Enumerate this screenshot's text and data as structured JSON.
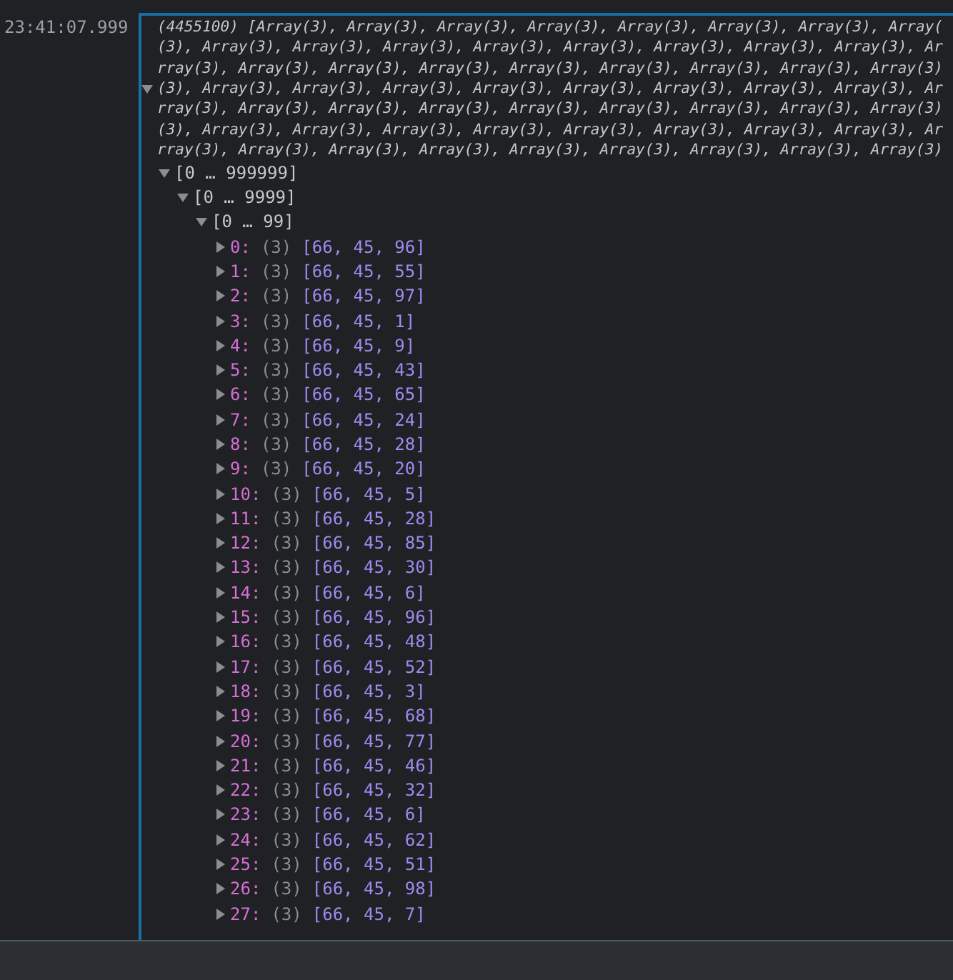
{
  "console_entry": {
    "timestamp": "23:41:07.999",
    "expanded": true,
    "summary_lines": [
      "(4455100) [Array(3), Array(3), Array(3), Array(3), Array(3), Array(3), Array(3), Array(",
      "(3), Array(3), Array(3), Array(3), Array(3), Array(3), Array(3), Array(3), Array(3), Ar",
      "rray(3), Array(3), Array(3), Array(3), Array(3), Array(3), Array(3), Array(3), Array(3)",
      "(3), Array(3), Array(3), Array(3), Array(3), Array(3), Array(3), Array(3), Array(3), Ar",
      "rray(3), Array(3), Array(3), Array(3), Array(3), Array(3), Array(3), Array(3), Array(3)",
      "(3), Array(3), Array(3), Array(3), Array(3), Array(3), Array(3), Array(3), Array(3), Ar",
      "rray(3), Array(3), Array(3), Array(3), Array(3), Array(3), Array(3), Array(3), Array(3)"
    ],
    "children": [
      {
        "label": "[0 … 999999]",
        "expanded": true,
        "children": [
          {
            "label": "[0 … 9999]",
            "expanded": true,
            "children": [
              {
                "label": "[0 … 99]",
                "expanded": true,
                "children": [
                  {
                    "key": "0:",
                    "count": "(3)",
                    "value": "[66, 45, 96]",
                    "expanded": false
                  },
                  {
                    "key": "1:",
                    "count": "(3)",
                    "value": "[66, 45, 55]",
                    "expanded": false
                  },
                  {
                    "key": "2:",
                    "count": "(3)",
                    "value": "[66, 45, 97]",
                    "expanded": false
                  },
                  {
                    "key": "3:",
                    "count": "(3)",
                    "value": "[66, 45, 1]",
                    "expanded": false
                  },
                  {
                    "key": "4:",
                    "count": "(3)",
                    "value": "[66, 45, 9]",
                    "expanded": false
                  },
                  {
                    "key": "5:",
                    "count": "(3)",
                    "value": "[66, 45, 43]",
                    "expanded": false
                  },
                  {
                    "key": "6:",
                    "count": "(3)",
                    "value": "[66, 45, 65]",
                    "expanded": false
                  },
                  {
                    "key": "7:",
                    "count": "(3)",
                    "value": "[66, 45, 24]",
                    "expanded": false
                  },
                  {
                    "key": "8:",
                    "count": "(3)",
                    "value": "[66, 45, 28]",
                    "expanded": false
                  },
                  {
                    "key": "9:",
                    "count": "(3)",
                    "value": "[66, 45, 20]",
                    "expanded": false
                  },
                  {
                    "key": "10:",
                    "count": "(3)",
                    "value": "[66, 45, 5]",
                    "expanded": false
                  },
                  {
                    "key": "11:",
                    "count": "(3)",
                    "value": "[66, 45, 28]",
                    "expanded": false
                  },
                  {
                    "key": "12:",
                    "count": "(3)",
                    "value": "[66, 45, 85]",
                    "expanded": false
                  },
                  {
                    "key": "13:",
                    "count": "(3)",
                    "value": "[66, 45, 30]",
                    "expanded": false
                  },
                  {
                    "key": "14:",
                    "count": "(3)",
                    "value": "[66, 45, 6]",
                    "expanded": false
                  },
                  {
                    "key": "15:",
                    "count": "(3)",
                    "value": "[66, 45, 96]",
                    "expanded": false
                  },
                  {
                    "key": "16:",
                    "count": "(3)",
                    "value": "[66, 45, 48]",
                    "expanded": false
                  },
                  {
                    "key": "17:",
                    "count": "(3)",
                    "value": "[66, 45, 52]",
                    "expanded": false
                  },
                  {
                    "key": "18:",
                    "count": "(3)",
                    "value": "[66, 45, 3]",
                    "expanded": false
                  },
                  {
                    "key": "19:",
                    "count": "(3)",
                    "value": "[66, 45, 68]",
                    "expanded": false
                  },
                  {
                    "key": "20:",
                    "count": "(3)",
                    "value": "[66, 45, 77]",
                    "expanded": false
                  },
                  {
                    "key": "21:",
                    "count": "(3)",
                    "value": "[66, 45, 46]",
                    "expanded": false
                  },
                  {
                    "key": "22:",
                    "count": "(3)",
                    "value": "[66, 45, 32]",
                    "expanded": false
                  },
                  {
                    "key": "23:",
                    "count": "(3)",
                    "value": "[66, 45, 6]",
                    "expanded": false
                  },
                  {
                    "key": "24:",
                    "count": "(3)",
                    "value": "[66, 45, 62]",
                    "expanded": false
                  },
                  {
                    "key": "25:",
                    "count": "(3)",
                    "value": "[66, 45, 51]",
                    "expanded": false
                  },
                  {
                    "key": "26:",
                    "count": "(3)",
                    "value": "[66, 45, 98]",
                    "expanded": false
                  },
                  {
                    "key": "27:",
                    "count": "(3)",
                    "value": "[66, 45, 7]",
                    "expanded": false
                  }
                ]
              }
            ]
          }
        ]
      }
    ]
  }
}
